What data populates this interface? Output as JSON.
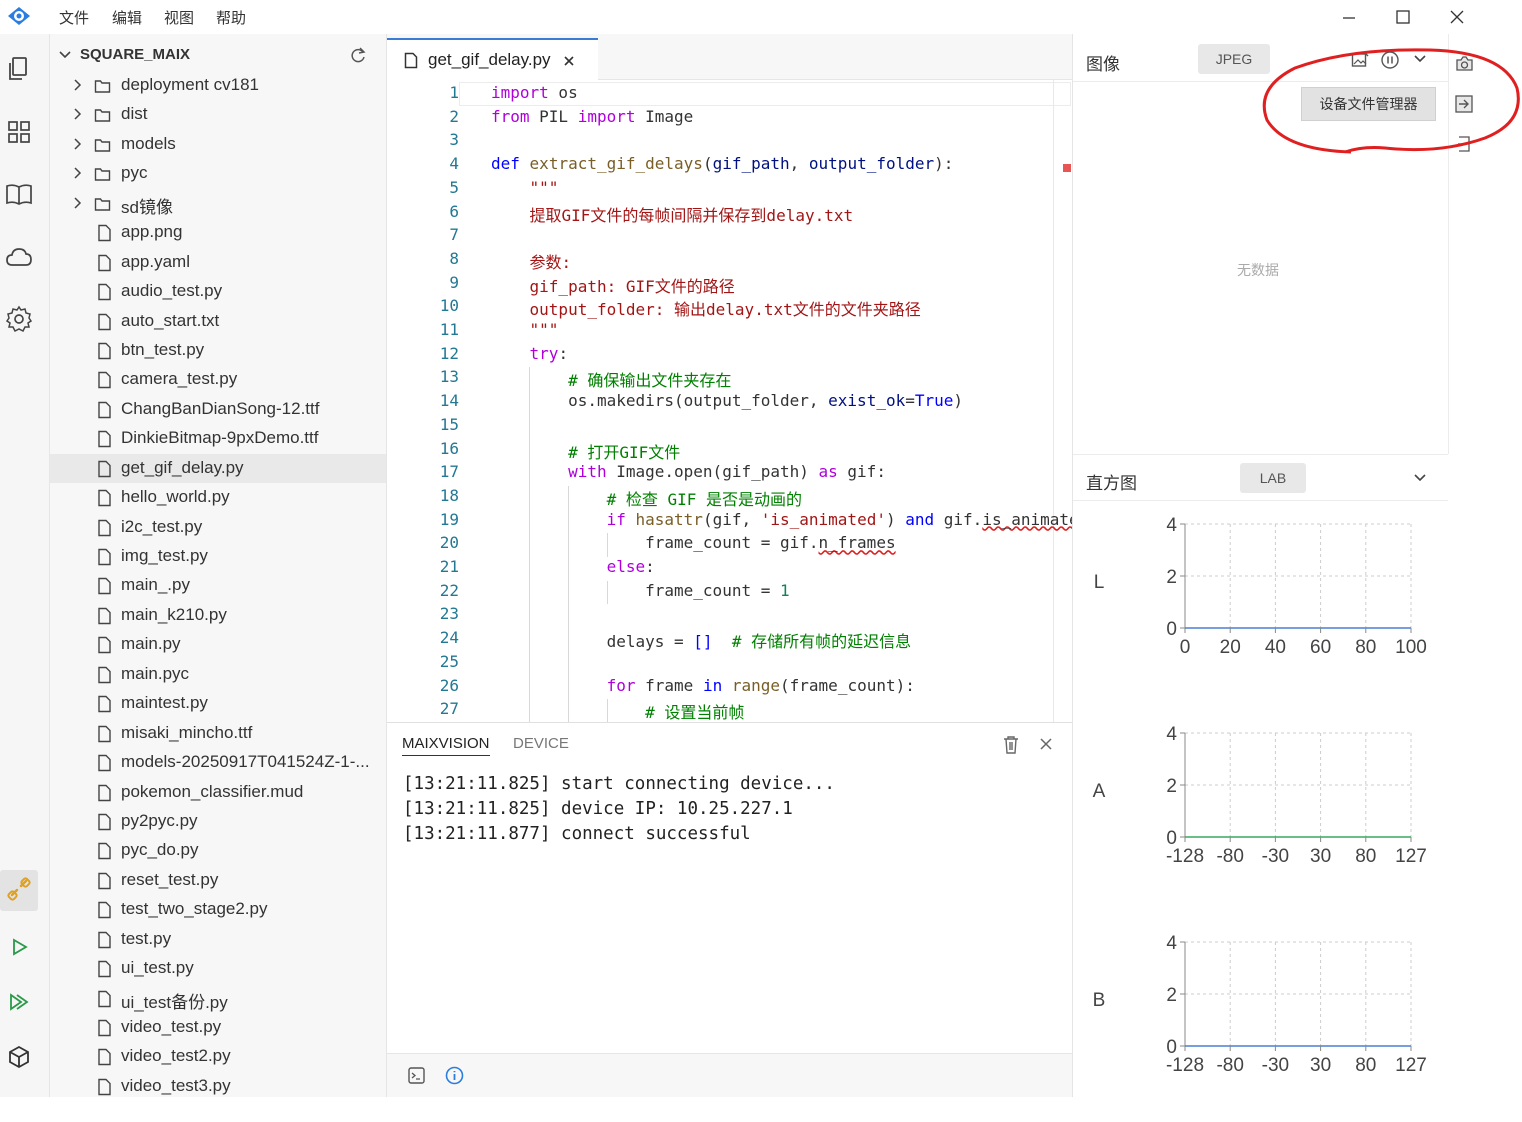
{
  "menu": [
    "文件",
    "编辑",
    "视图",
    "帮助"
  ],
  "explorer": {
    "title": "SQUARE_MAIX",
    "folders": [
      "deployment cv181",
      "dist",
      "models",
      "pyc",
      "sd镜像"
    ],
    "files": [
      "app.png",
      "app.yaml",
      "audio_test.py",
      "auto_start.txt",
      "btn_test.py",
      "camera_test.py",
      "ChangBanDianSong-12.ttf",
      "DinkieBitmap-9pxDemo.ttf",
      "get_gif_delay.py",
      "hello_world.py",
      "i2c_test.py",
      "img_test.py",
      "main_.py",
      "main_k210.py",
      "main.py",
      "main.pyc",
      "maintest.py",
      "misaki_mincho.ttf",
      "models-20250917T041524Z-1-...",
      "pokemon_classifier.mud",
      "py2pyc.py",
      "pyc_do.py",
      "reset_test.py",
      "test_two_stage2.py",
      "test.py",
      "ui_test.py",
      "ui_test备份.py",
      "video_test.py",
      "video_test2.py",
      "video_test3.py"
    ],
    "active_file": "get_gif_delay.py"
  },
  "editor": {
    "tab_label": "get_gif_delay.py",
    "line_numbers": [
      "1",
      "2",
      "3",
      "4",
      "5",
      "6",
      "7",
      "8",
      "9",
      "10",
      "11",
      "12",
      "13",
      "14",
      "15",
      "16",
      "17",
      "18",
      "19",
      "20",
      "21",
      "22",
      "23",
      "24",
      "25",
      "26",
      "27"
    ]
  },
  "panel": {
    "tabs": [
      "MAIXVISION",
      "DEVICE"
    ],
    "lines": [
      "[13:21:11.825] start connecting device...",
      "[13:21:11.825] device IP: 10.25.227.1",
      "[13:21:11.877] connect successful"
    ]
  },
  "image_panel": {
    "title": "图像",
    "format": "JPEG",
    "empty_text": "无数据",
    "popup_label": "设备文件管理器"
  },
  "histogram": {
    "title": "直方图",
    "mode": "LAB",
    "charts": [
      {
        "channel": "L",
        "yticks": [
          "4",
          "2",
          "0"
        ],
        "xticks": [
          "0",
          "20",
          "40",
          "60",
          "80",
          "100"
        ],
        "line_color": "#4a7fd4"
      },
      {
        "channel": "A",
        "yticks": [
          "4",
          "2",
          "0"
        ],
        "xticks": [
          "-128",
          "-80",
          "-30",
          "30",
          "80",
          "127"
        ],
        "line_color": "#3aaa5c"
      },
      {
        "channel": "B",
        "yticks": [
          "4",
          "2",
          "0"
        ],
        "xticks": [
          "-128",
          "-80",
          "-30",
          "30",
          "80",
          "127"
        ],
        "line_color": "#4a7fd4"
      }
    ]
  },
  "colors": {
    "accent": "#3a7bd5",
    "annotation": "#e02020"
  }
}
